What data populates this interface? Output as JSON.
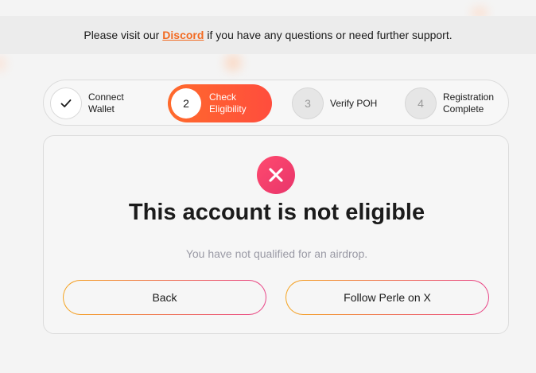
{
  "banner": {
    "prefix": "Please visit our",
    "link_label": "Discord",
    "suffix": "if you have any questions or need further support."
  },
  "steps": [
    {
      "number": "",
      "label": "Connect Wallet",
      "status": "complete"
    },
    {
      "number": "2",
      "label": "Check Eligibility",
      "status": "active"
    },
    {
      "number": "3",
      "label": "Verify POH",
      "status": "pending"
    },
    {
      "number": "4",
      "label": "Registration Complete",
      "status": "pending"
    }
  ],
  "result": {
    "icon": "close-icon",
    "title": "This account is not eligible",
    "subtitle": "You have not qualified for an airdrop."
  },
  "actions": {
    "back_label": "Back",
    "follow_label": "Follow Perle on X"
  },
  "colors": {
    "accent": "#ff5a36",
    "link": "#f26a21",
    "error": "#ee3d6c"
  }
}
